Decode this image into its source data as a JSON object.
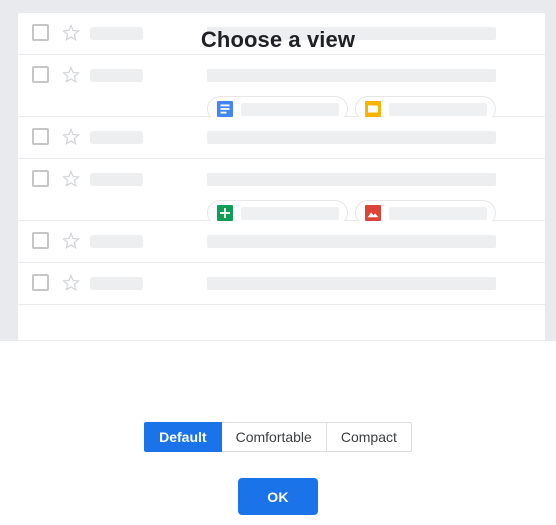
{
  "theme": {
    "background": "#e8eaed",
    "panel_background": "#ffffff",
    "placeholder": "#eceef0",
    "divider": "#e8eaed",
    "accent": "#1a73e8",
    "text_primary": "#202124",
    "text_secondary": "#3c4043"
  },
  "mail_list": {
    "rows": [
      {
        "checkbox": "unchecked-checkbox",
        "star": "star-outline-icon",
        "has_attachments": false,
        "attachments": []
      },
      {
        "checkbox": "unchecked-checkbox",
        "star": "star-outline-icon",
        "has_attachments": true,
        "attachments": [
          {
            "icon": "google-docs-icon",
            "color": "#4285f4"
          },
          {
            "icon": "google-slides-icon",
            "color": "#f4b400"
          }
        ]
      },
      {
        "checkbox": "unchecked-checkbox",
        "star": "star-outline-icon",
        "has_attachments": false,
        "attachments": []
      },
      {
        "checkbox": "unchecked-checkbox",
        "star": "star-outline-icon",
        "has_attachments": true,
        "attachments": [
          {
            "icon": "google-sheets-icon",
            "color": "#0f9d58"
          },
          {
            "icon": "image-file-icon",
            "color": "#db4437"
          }
        ]
      },
      {
        "checkbox": "unchecked-checkbox",
        "star": "star-outline-icon",
        "has_attachments": false,
        "attachments": []
      },
      {
        "checkbox": "unchecked-checkbox",
        "star": "star-outline-icon",
        "has_attachments": false,
        "attachments": []
      }
    ]
  },
  "dialog": {
    "title": "Choose a view",
    "view_options": [
      {
        "label": "Default",
        "selected": true
      },
      {
        "label": "Comfortable",
        "selected": false
      },
      {
        "label": "Compact",
        "selected": false
      }
    ],
    "confirm_label": "OK"
  }
}
